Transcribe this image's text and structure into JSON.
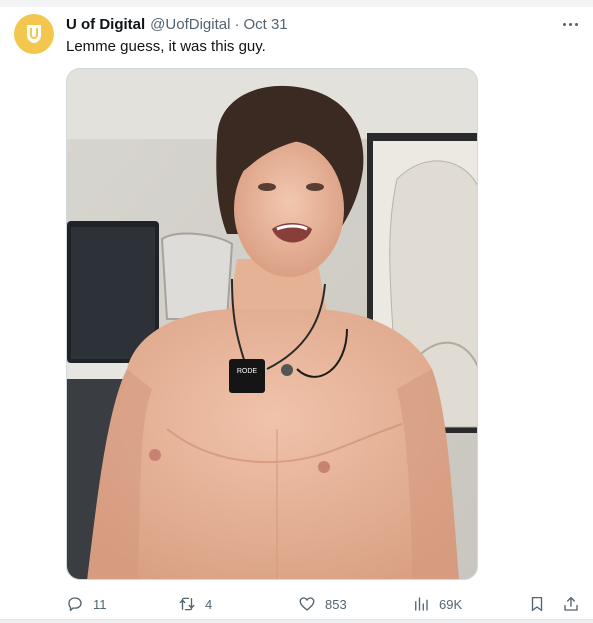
{
  "tweet": {
    "display_name": "U of Digital",
    "handle": "@UofDigital",
    "separator": "·",
    "date": "Oct 31",
    "text": "Lemme guess, it was this guy.",
    "avatar_color": "#f3c74e"
  },
  "media": {
    "type": "video-frame",
    "mic_label": "RODE"
  },
  "actions": {
    "reply": {
      "icon": "reply-icon",
      "count": "11"
    },
    "retweet": {
      "icon": "retweet-icon",
      "count": "4"
    },
    "like": {
      "icon": "heart-icon",
      "count": "853"
    },
    "views": {
      "icon": "analytics-icon",
      "count": "69K"
    },
    "bookmark": {
      "icon": "bookmark-icon"
    },
    "share": {
      "icon": "share-icon"
    }
  },
  "colors": {
    "text_primary": "#0f1419",
    "text_secondary": "#536471",
    "border": "#cfd9de"
  }
}
